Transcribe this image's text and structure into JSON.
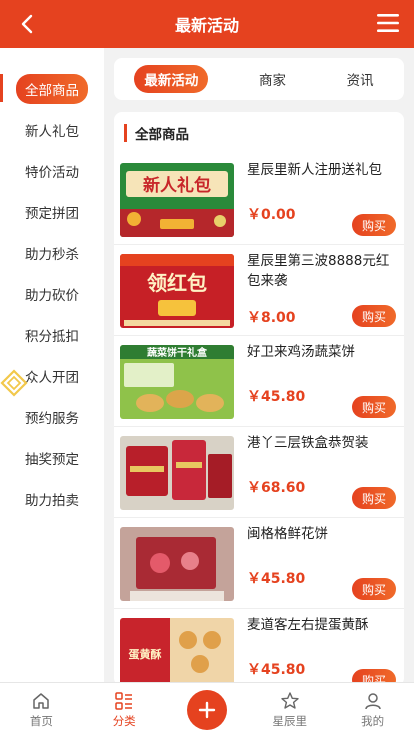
{
  "header": {
    "title": "最新活动"
  },
  "sidebar": {
    "items": [
      {
        "label": "全部商品"
      },
      {
        "label": "新人礼包"
      },
      {
        "label": "特价活动"
      },
      {
        "label": "预定拼团"
      },
      {
        "label": "助力秒杀"
      },
      {
        "label": "助力砍价"
      },
      {
        "label": "积分抵扣"
      },
      {
        "label": "众人开团"
      },
      {
        "label": "预约服务"
      },
      {
        "label": "抽奖预定"
      },
      {
        "label": "助力拍卖"
      }
    ],
    "active_index": 0
  },
  "tabs": [
    {
      "label": "最新活动"
    },
    {
      "label": "商家"
    },
    {
      "label": "资讯"
    }
  ],
  "panel": {
    "title": "全部商品"
  },
  "products": [
    {
      "name": "星辰里新人注册送礼包",
      "price": "￥0.00",
      "buy": "购买",
      "image_text": "新人礼包"
    },
    {
      "name": "星辰里第三波8888元红包来袭",
      "price": "￥8.00",
      "buy": "购买",
      "image_text": "领红包"
    },
    {
      "name": "好卫来鸡汤蔬菜饼",
      "price": "￥45.80",
      "buy": "购买",
      "image_text": "蔬菜饼干礼盒"
    },
    {
      "name": "港丫三层铁盒恭贺装",
      "price": "￥68.60",
      "buy": "购买",
      "image_text": ""
    },
    {
      "name": "闽格格鲜花饼",
      "price": "￥45.80",
      "buy": "购买",
      "image_text": ""
    },
    {
      "name": "麦道客左右提蛋黄酥",
      "price": "￥45.80",
      "buy": "购买",
      "image_text": "蛋黄酥"
    }
  ],
  "bottom_nav": [
    {
      "label": "首页",
      "icon": "home-icon"
    },
    {
      "label": "分类",
      "icon": "category-icon"
    },
    {
      "label": "",
      "icon": "plus-icon"
    },
    {
      "label": "星辰里",
      "icon": "star-icon"
    },
    {
      "label": "我的",
      "icon": "user-icon"
    }
  ],
  "colors": {
    "accent": "#e5421f",
    "accent_light": "#f06a2a",
    "background": "#f2f2f2"
  }
}
